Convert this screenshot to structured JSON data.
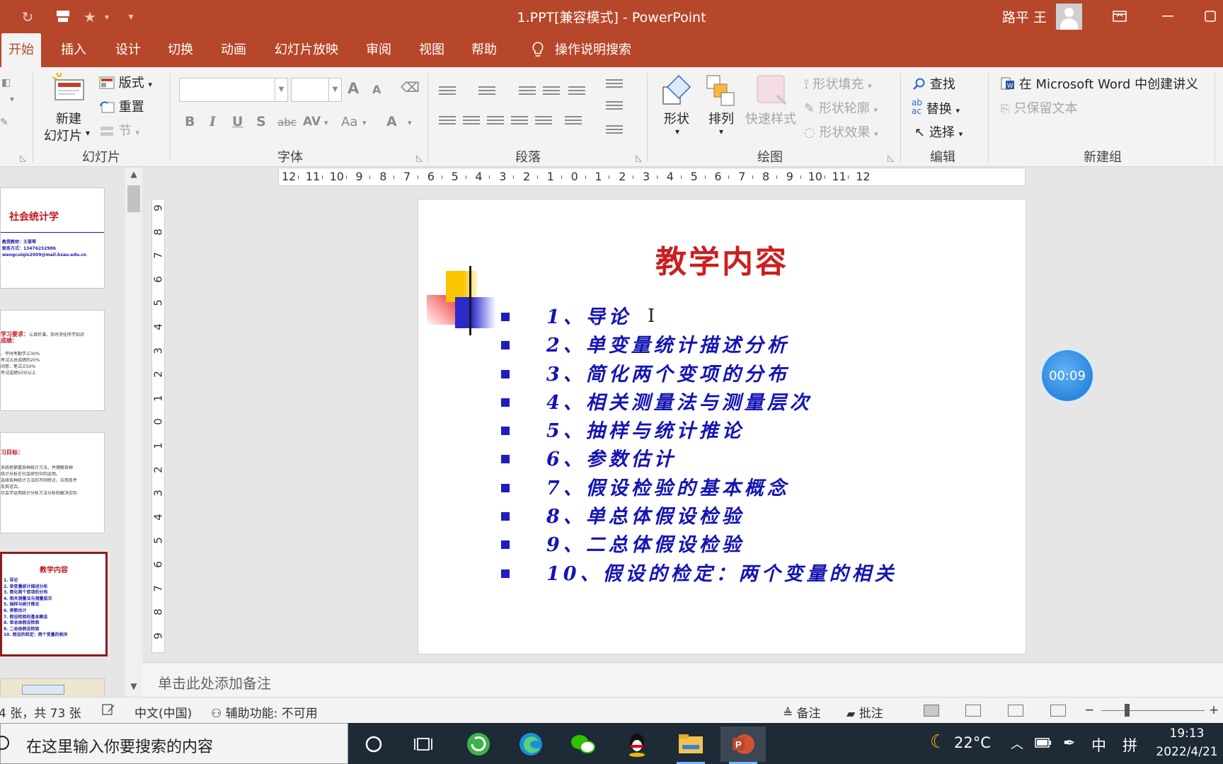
{
  "window": {
    "title": "1.PPT[兼容模式] - PowerPoint",
    "user_name": "路平 王",
    "qat": {
      "redo": "↻",
      "more": "▾"
    }
  },
  "tabs": [
    "开始",
    "插入",
    "设计",
    "切换",
    "动画",
    "幻灯片放映",
    "审阅",
    "视图",
    "帮助"
  ],
  "tell_me": "操作说明搜索",
  "ribbon": {
    "slides_group": {
      "label": "幻灯片",
      "new_slide_line1": "新建",
      "new_slide_line2": "幻灯片",
      "layout": "版式",
      "reset": "重置",
      "section": "节"
    },
    "font_group": {
      "label": "字体",
      "font_name": "",
      "font_size": "",
      "grow": "A",
      "shrink": "A",
      "bold": "B",
      "italic": "I",
      "underline": "U",
      "shadow": "S",
      "strike": "abc",
      "spacing": "AV",
      "case": "Aa",
      "color": "A"
    },
    "paragraph_group": {
      "label": "段落"
    },
    "drawing_group": {
      "label": "绘图",
      "shapes": "形状",
      "arrange": "排列",
      "quick_styles": "快速样式",
      "shape_fill": "形状填充",
      "shape_outline": "形状轮廓",
      "shape_effects": "形状效果"
    },
    "editing_group": {
      "label": "编辑",
      "find": "查找",
      "replace": "替换",
      "select": "选择"
    },
    "new_group": {
      "label": "新建组",
      "create_handout": "在 Microsoft Word 中创建讲义",
      "keep_text": "只保留文本"
    }
  },
  "thumbnails": [
    {
      "title": "社会统计学",
      "lines": [
        "教授教师：王翠琴",
        "联系方式：13476232986",
        "wangcuiqin2009@mail.hzau.edu.cn"
      ]
    },
    {
      "heading": "学习要求：",
      "heading_rest": "认真听课，及时消化所学知识",
      "sub": "成绩：",
      "lines": [
        "、平时考勤学占30%",
        "考试占总成绩的20%",
        "间卷、笔试占50%",
        "考试成绩50分以上"
      ]
    },
    {
      "heading": "习目标：",
      "lines": [
        "系统地掌握各种统计方法，并理解各种",
        "统计分析在社会研究中的运用。",
        "选择各种统计方法的不同特点，应用条件",
        "及其适合。",
        "社会学运用统计分析方法分析和解决实际"
      ]
    },
    {
      "title": "教学内容",
      "lines": [
        "1. 导论",
        "2. 单变量统计描述分析",
        "3. 简化两个变项的分布",
        "4. 相关测量法与测量层次",
        "5. 抽样与统计推论",
        "6. 参数估计",
        "7. 假设检验的基本概念",
        "8. 单总体假设检验",
        "9. 二总体假设检验",
        "10. 假设的检定：两个变量的相关"
      ]
    }
  ],
  "ruler": {
    "h_labels": [
      "12",
      "11",
      "10",
      "9",
      "8",
      "7",
      "6",
      "5",
      "4",
      "3",
      "2",
      "1",
      "0",
      "1",
      "2",
      "3",
      "4",
      "5",
      "6",
      "7",
      "8",
      "9",
      "10",
      "11",
      "12"
    ],
    "v_labels": [
      "9",
      "8",
      "7",
      "6",
      "5",
      "4",
      "3",
      "2",
      "1",
      "0",
      "1",
      "2",
      "3",
      "4",
      "5",
      "6",
      "7",
      "8",
      "9"
    ]
  },
  "slide": {
    "title": "教学内容",
    "items": [
      "1、导论",
      "2、单变量统计描述分析",
      "3、简化两个变项的分布",
      "4、相关测量法与测量层次",
      "5、抽样与统计推论",
      "6、参数估计",
      "7、假设检验的基本概念",
      "8、单总体假设检验",
      "9、二总体假设检验",
      "10、假设的检定：两个变量的相关"
    ]
  },
  "timer": "00:09",
  "notes_placeholder": "单击此处添加备注",
  "status": {
    "slide_count": "4 张，共 73 张",
    "language": "中文(中国)",
    "accessibility": "辅助功能: 不可用",
    "notes": "备注",
    "comments": "批注",
    "zoom_minus": "−",
    "zoom_plus": "+"
  },
  "taskbar": {
    "search_placeholder": "在这里输入你要搜索的内容",
    "temperature": "22°C",
    "ime_lang": "中",
    "ime_mode": "拼",
    "time": "19:13",
    "date": "2022/4/21"
  },
  "colors": {
    "accent": "#b7472a",
    "slide_title": "#cc1f1f",
    "slide_text": "#1414b4",
    "selected_thumb_border": "#8e1c1c"
  }
}
